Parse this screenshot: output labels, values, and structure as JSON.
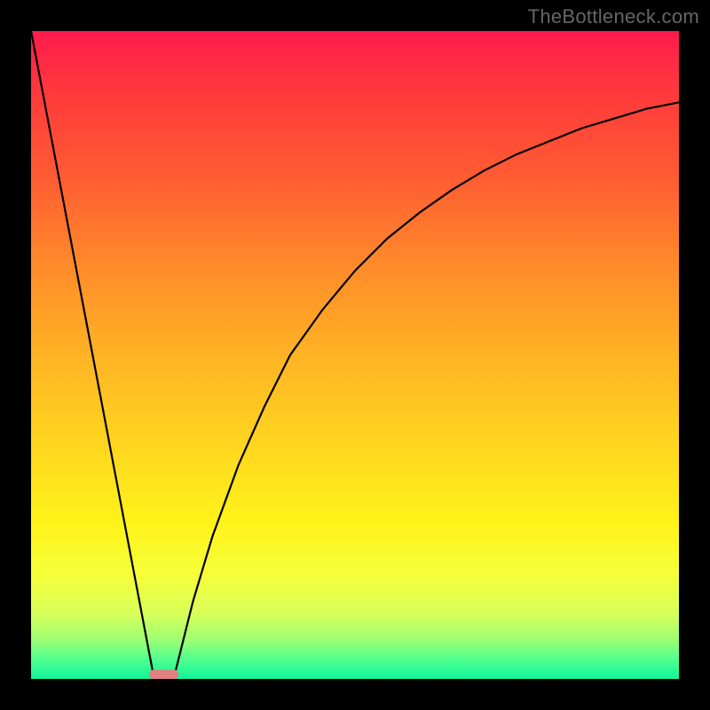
{
  "watermark": "TheBottleneck.com",
  "chart_data": {
    "type": "line",
    "title": "",
    "xlabel": "",
    "ylabel": "",
    "xlim": [
      0,
      100
    ],
    "ylim": [
      0,
      100
    ],
    "grid": false,
    "series": [
      {
        "name": "left-falling-edge",
        "x": [
          0,
          19
        ],
        "y": [
          100,
          0
        ]
      },
      {
        "name": "right-rising-curve",
        "x": [
          22,
          25,
          28,
          32,
          36,
          40,
          45,
          50,
          55,
          60,
          65,
          70,
          75,
          80,
          85,
          90,
          95,
          100
        ],
        "y": [
          0,
          12,
          22,
          33,
          42,
          50,
          57,
          63,
          68,
          72,
          75.5,
          78.5,
          81,
          83,
          85,
          86.5,
          88,
          89
        ]
      }
    ],
    "marker": {
      "name": "bottleneck-marker",
      "x": 20.5,
      "y": 0,
      "width": 4.5,
      "height": 1.4,
      "color": "#e08080"
    },
    "background_gradient": {
      "top": "#ff1a4d",
      "bottom": "#10f59a"
    }
  }
}
